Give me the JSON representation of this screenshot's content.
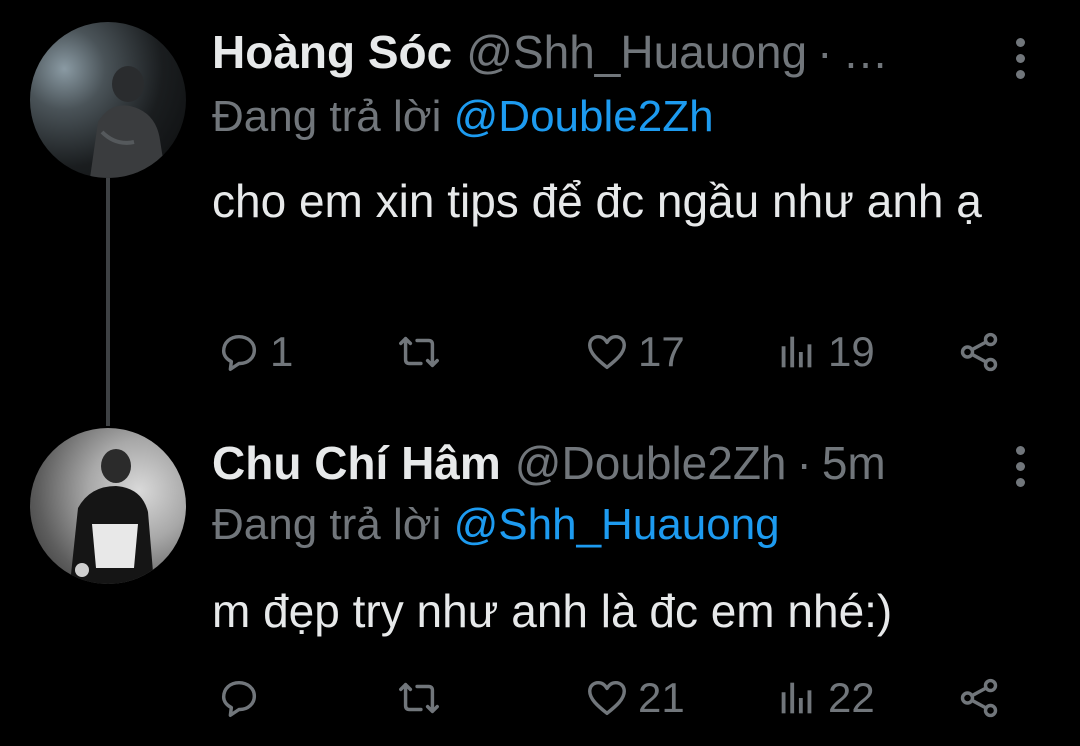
{
  "tweets": [
    {
      "name": "Hoàng Sóc",
      "handle": "@Shh_Huauong",
      "dot": "·",
      "time": "…",
      "replying_prefix": "Đang trả lời",
      "replying_to": "@Double2Zh",
      "text": "cho em xin tips để đc ngầu như anh ạ",
      "replies": "1",
      "retweets": "",
      "likes": "17",
      "views": "19",
      "icons": {
        "reply": "reply-icon",
        "retweet": "retweet-icon",
        "like": "heart-icon",
        "views": "views-icon",
        "share": "share-icon",
        "more": "more-vertical-icon"
      }
    },
    {
      "name": "Chu Chí Hâm",
      "handle": "@Double2Zh",
      "dot": "·",
      "time": "5m",
      "replying_prefix": "Đang trả lời",
      "replying_to": "@Shh_Huauong",
      "text": "m đẹp try như anh là đc em nhé:)",
      "replies": "",
      "retweets": "",
      "likes": "21",
      "views": "22",
      "icons": {
        "reply": "reply-icon",
        "retweet": "retweet-icon",
        "like": "heart-icon",
        "views": "views-icon",
        "share": "share-icon",
        "more": "more-vertical-icon"
      }
    }
  ],
  "colors": {
    "background": "#000000",
    "text": "#e7e9ea",
    "secondary": "#71767b",
    "accent": "#1d9bf0",
    "thread_line": "#3e4144"
  }
}
